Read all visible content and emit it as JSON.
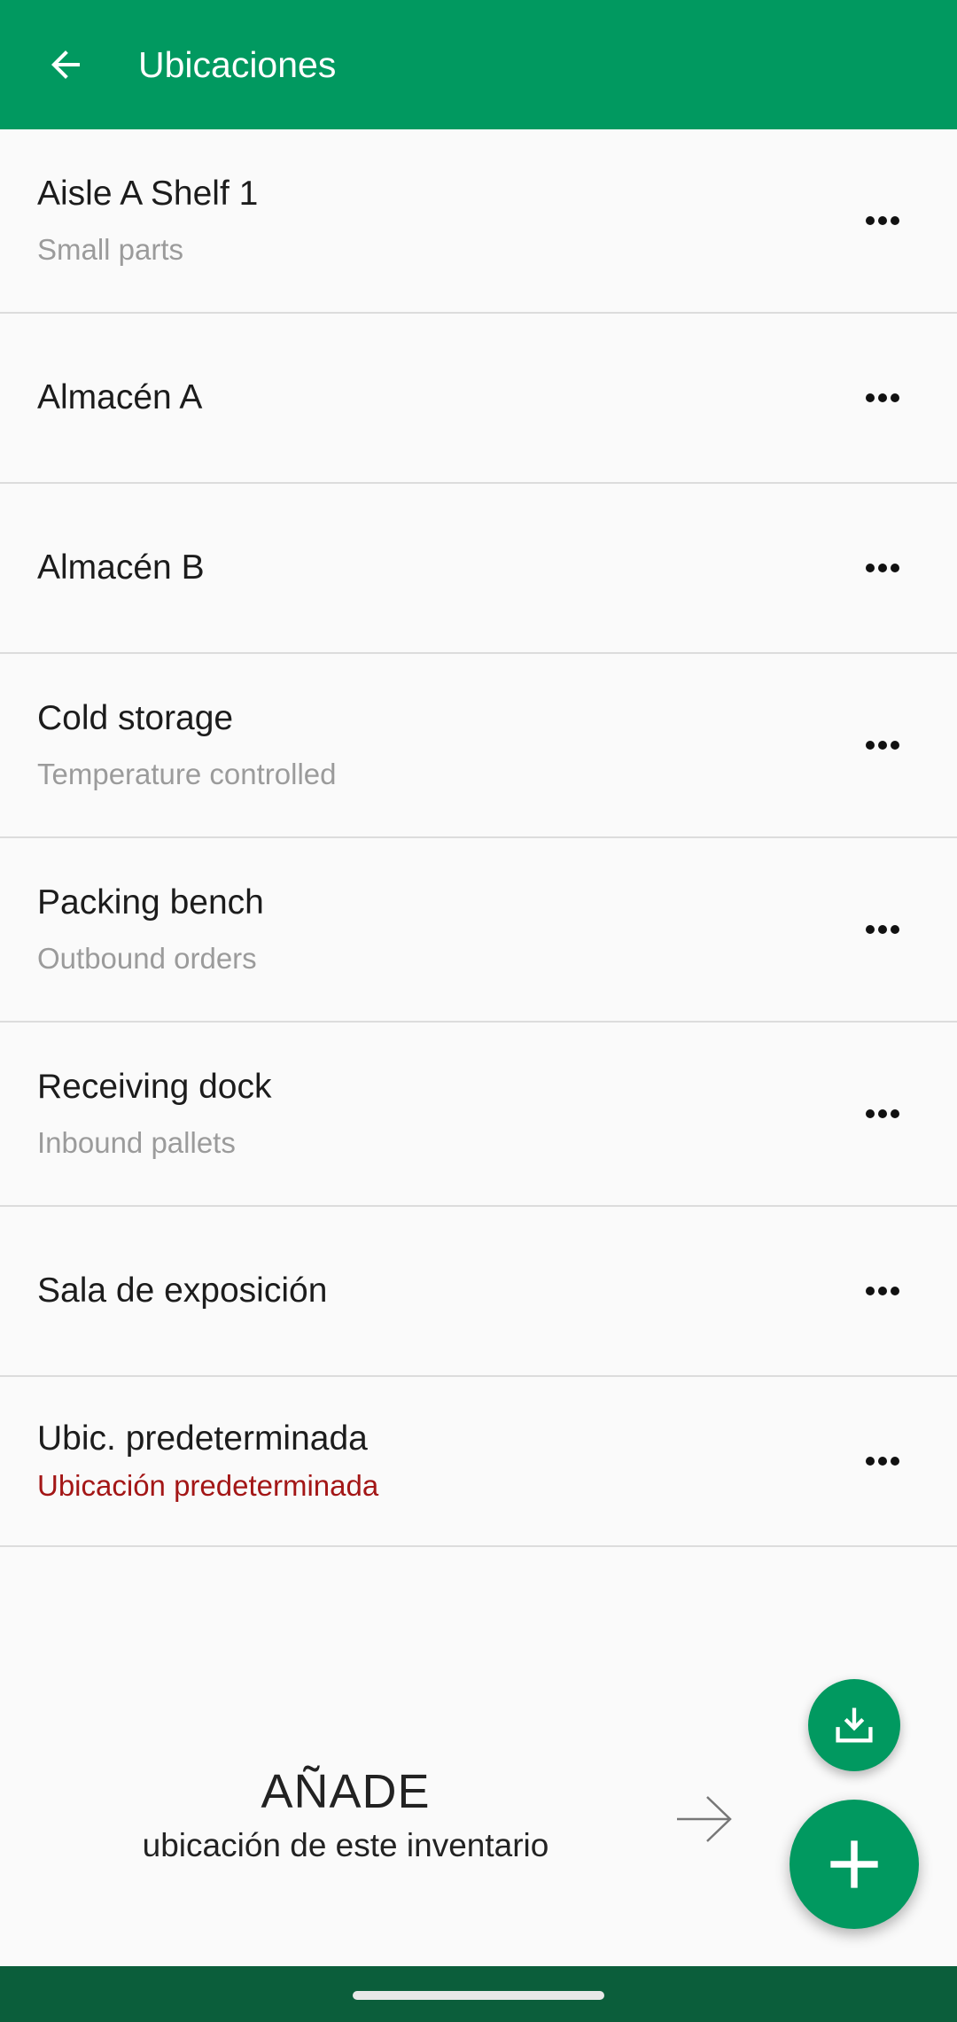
{
  "header": {
    "title": "Ubicaciones",
    "back_icon": "arrow-back-icon",
    "background": "#019960"
  },
  "locations": [
    {
      "name": "Aisle A Shelf 1",
      "subtitle": "Small parts"
    },
    {
      "name": "Almacén A",
      "subtitle": ""
    },
    {
      "name": "Almacén B",
      "subtitle": ""
    },
    {
      "name": "Cold storage",
      "subtitle": "Temperature controlled"
    },
    {
      "name": "Packing bench",
      "subtitle": "Outbound orders"
    },
    {
      "name": "Receiving dock",
      "subtitle": "Inbound pallets"
    },
    {
      "name": "Sala de exposición",
      "subtitle": ""
    },
    {
      "name": "Ubic. predeterminada",
      "subtitle": "Ubicación predeterminada",
      "subtitle_color": "#a31616"
    }
  ],
  "more_icon": "more-horizontal-icon",
  "empty_hint": {
    "title": "AÑADE",
    "subtitle": "ubicación de este inventario",
    "arrow_icon": "arrow-right-icon"
  },
  "fabs": {
    "import_icon": "download-icon",
    "add_icon": "plus-icon",
    "color": "#019960"
  },
  "navbar": {
    "color": "#0b5e3b"
  }
}
